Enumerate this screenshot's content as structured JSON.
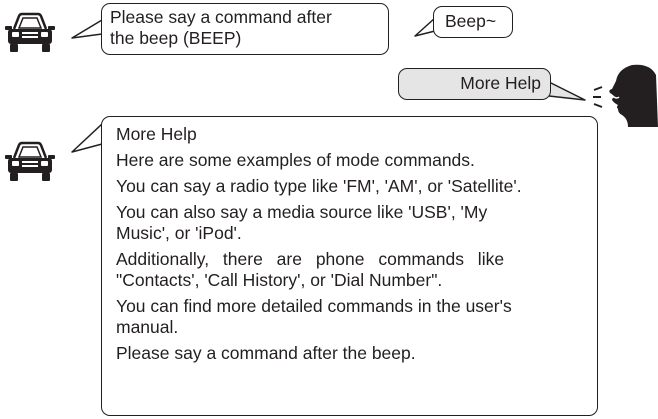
{
  "prompt_bubble": {
    "line1": "Please say a command after",
    "line2": "the beep (BEEP)"
  },
  "beep_bubble": {
    "text": "Beep~"
  },
  "user_bubble": {
    "text": "More Help"
  },
  "help_bubble": {
    "title": "More Help",
    "p1": "Here are some examples of mode commands.",
    "p2": "You can say a radio type like 'FM', 'AM', or 'Satellite'.",
    "p3a": "You can also say a media source like 'USB', 'My",
    "p3b": "Music', or 'iPod'.",
    "p4a": "Additionally, there are phone commands like",
    "p4b": "\"Contacts', 'Call History', or 'Dial Number\".",
    "p5a": "You can find more detailed commands in the user's",
    "p5b": "manual.",
    "p6": "Please say a command after the beep."
  },
  "icons": {
    "car": "car-icon",
    "speaker": "speaking-person-icon"
  },
  "colors": {
    "ink": "#231f20",
    "user_bubble_fill": "#e5e5e5"
  }
}
